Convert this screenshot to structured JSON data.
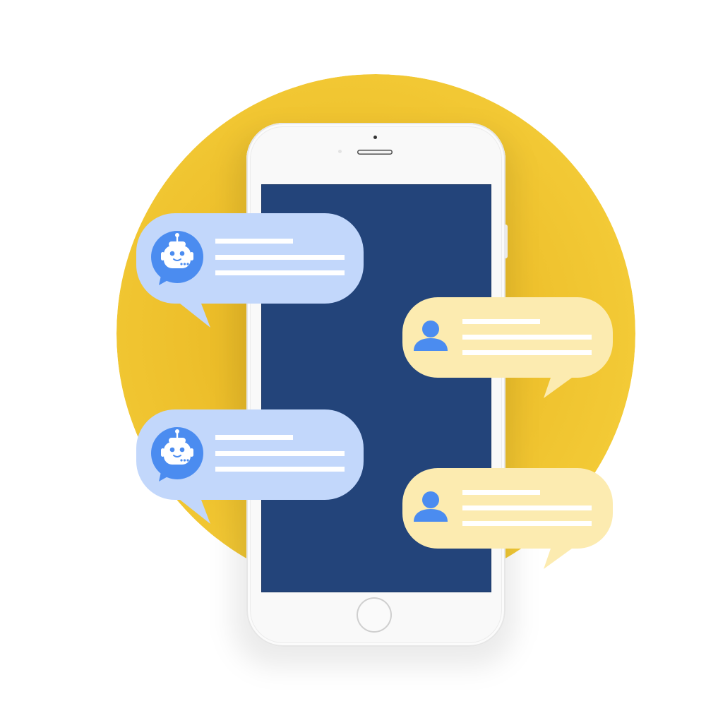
{
  "illustration": {
    "subject": "chatbot-conversation-on-smartphone",
    "colors": {
      "background": "#ffffff",
      "circle": "#f2c934",
      "circle_shade": "#e4b41f",
      "phone_body": "#f9f9f9",
      "screen": "#23447a",
      "bot_bubble": "#c2d7fb",
      "user_bubble": "#fcebb0",
      "icon_blue": "#4b8cf0",
      "text_line": "#ffffff"
    },
    "messages": [
      {
        "sender": "bot",
        "avatar_icon": "robot-icon",
        "text_lines": 3
      },
      {
        "sender": "user",
        "avatar_icon": "user-icon",
        "text_lines": 3
      },
      {
        "sender": "bot",
        "avatar_icon": "robot-icon",
        "text_lines": 3
      },
      {
        "sender": "user",
        "avatar_icon": "user-icon",
        "text_lines": 3
      }
    ]
  }
}
